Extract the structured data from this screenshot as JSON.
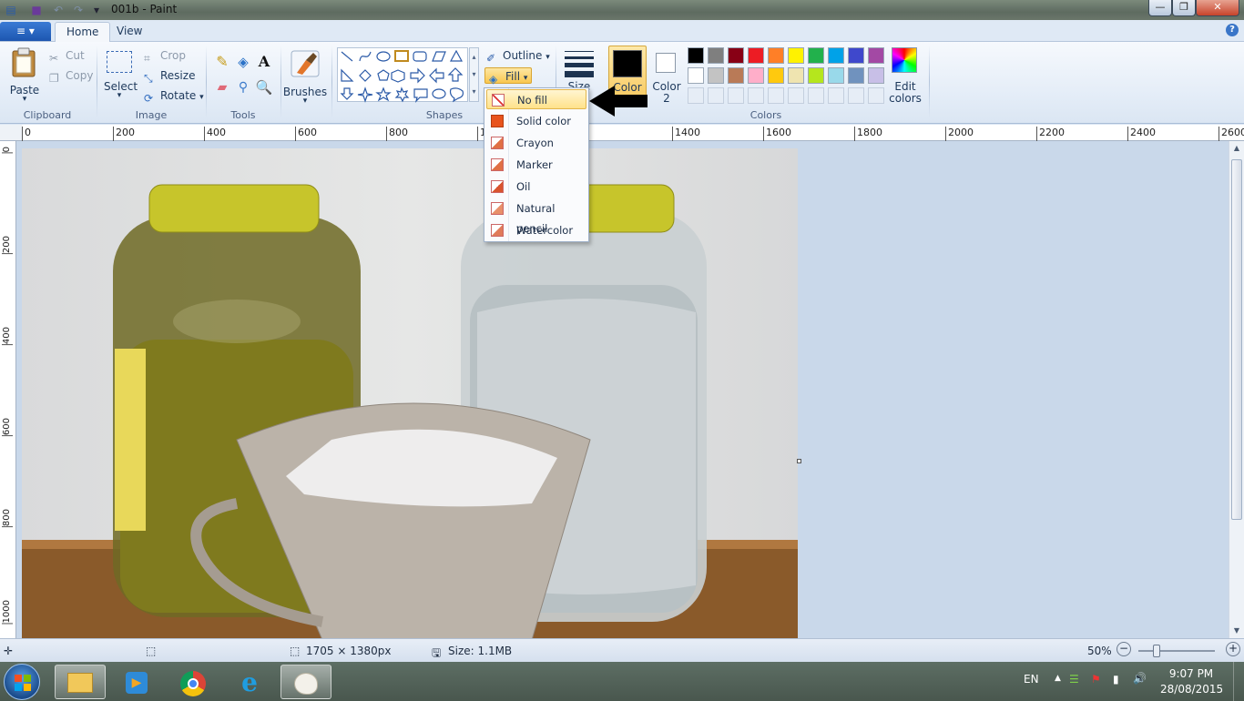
{
  "window": {
    "title": "001b - Paint",
    "controls": {
      "minimize": "—",
      "maximize": "❐",
      "close": "✕"
    }
  },
  "tabs": {
    "app_menu": "≡ ▾",
    "home": "Home",
    "view": "View",
    "help": "?"
  },
  "ribbon": {
    "clipboard": {
      "paste": "Paste",
      "cut": "Cut",
      "copy": "Copy",
      "group": "Clipboard"
    },
    "image": {
      "select": "Select",
      "crop": "Crop",
      "resize": "Resize",
      "rotate": "Rotate",
      "group": "Image"
    },
    "tools": {
      "group": "Tools"
    },
    "brushes": {
      "label": "Brushes"
    },
    "shapes": {
      "outline": "Outline",
      "fill": "Fill",
      "group": "Shapes"
    },
    "size": {
      "label": "Size"
    },
    "colors": {
      "color1": "Color 1",
      "color1_label": "Color",
      "color2_label": "Color",
      "color2_num": "2",
      "edit": "Edit colors",
      "edit_line1": "Edit",
      "edit_line2": "colors",
      "group": "Colors",
      "palette_row1": [
        "#000000",
        "#7f7f7f",
        "#880015",
        "#ed1c24",
        "#ff7f27",
        "#fff200",
        "#22b14c",
        "#00a2e8",
        "#3f48cc",
        "#a349a4"
      ],
      "palette_row2": [
        "#ffffff",
        "#c3c3c3",
        "#b97a57",
        "#ffaec9",
        "#ffc90e",
        "#efe4b0",
        "#b5e61d",
        "#99d9ea",
        "#7092be",
        "#c8bfe7"
      ]
    }
  },
  "fill_menu": {
    "items": [
      "No fill",
      "Solid color",
      "Crayon",
      "Marker",
      "Oil",
      "Natural pencil",
      "Watercolor"
    ],
    "selected": "No fill"
  },
  "rulers": {
    "h_ticks": [
      "0",
      "200",
      "400",
      "600",
      "800",
      "1",
      "0",
      "1400",
      "1600",
      "1800",
      "2000",
      "2200",
      "2400",
      "2600"
    ],
    "v_ticks": [
      "0",
      "200",
      "400",
      "600",
      "800",
      "1000"
    ]
  },
  "status": {
    "dimensions": "1705 × 1380px",
    "size": "Size: 1.1MB",
    "zoom": "50%"
  },
  "taskbar": {
    "lang": "EN",
    "time": "9:07 PM",
    "date": "28/08/2015"
  }
}
